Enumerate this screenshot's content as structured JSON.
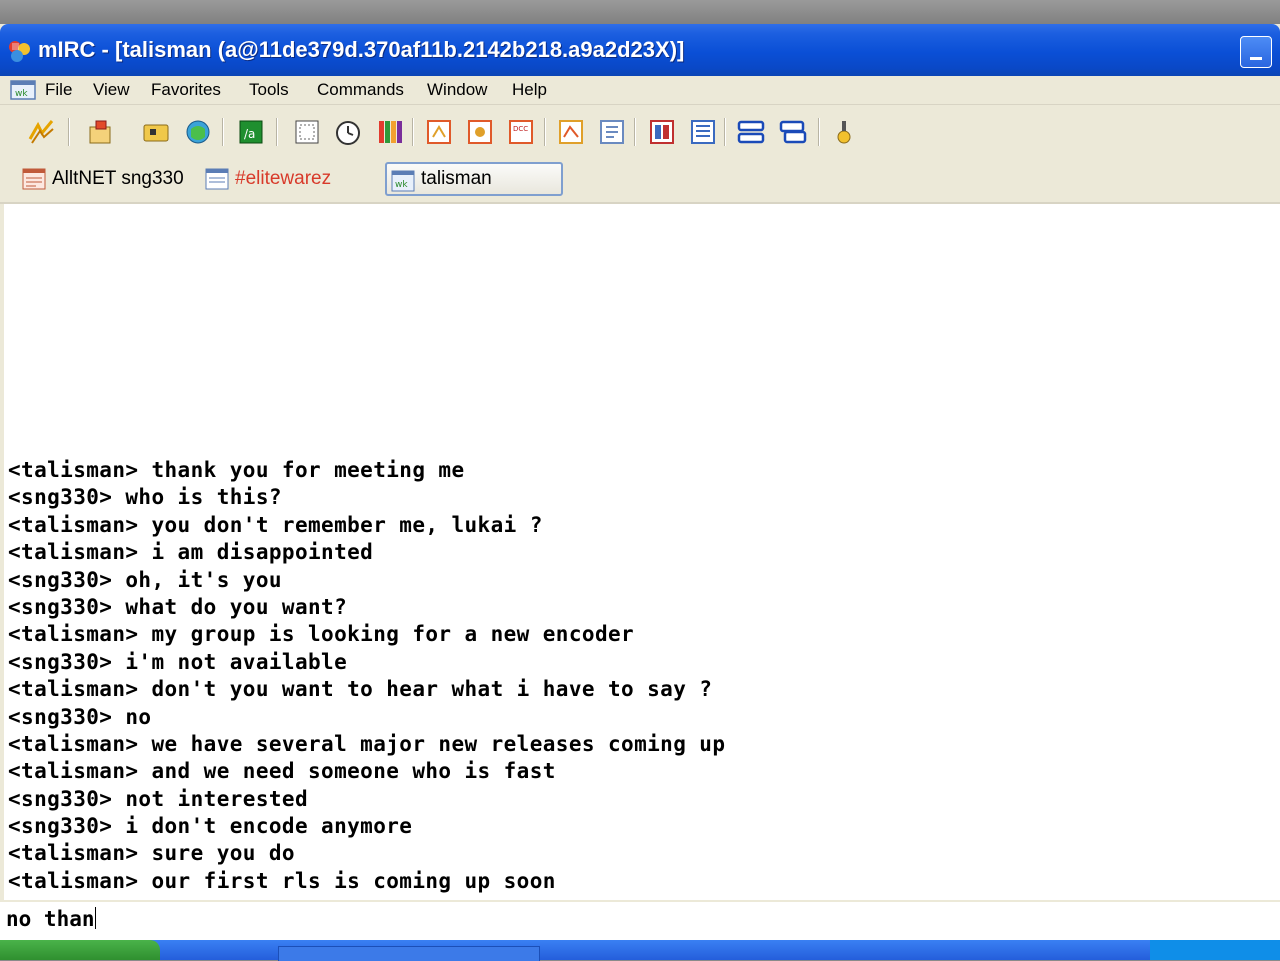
{
  "window": {
    "title": "mIRC - [talisman (a@11de379d.370af11b.2142b218.a9a2d23X)]"
  },
  "menu": {
    "items": [
      "File",
      "View",
      "Favorites",
      "Tools",
      "Commands",
      "Window",
      "Help"
    ]
  },
  "toolbar": {
    "buttons": [
      "connect-icon",
      "options-icon",
      "channels-list-icon",
      "address-book-icon",
      "scripts-editor-icon",
      "notify-list-icon",
      "timer-icon",
      "colors-icon",
      "send-file-icon",
      "chat-icon",
      "dcc-options-icon",
      "received-files-icon",
      "logs-icon",
      "tile-windows-icon",
      "cascade-windows-icon",
      "arrange-icon",
      "help-icon"
    ]
  },
  "switchbar": {
    "tabs": [
      {
        "label": "AlltNET sng330",
        "color": "#000000",
        "active": false
      },
      {
        "label": "#elitewarez",
        "color": "#d83a2a",
        "active": false
      },
      {
        "label": "talisman",
        "color": "#000000",
        "active": true
      }
    ]
  },
  "chat": {
    "lines": [
      "<talisman> thank you for meeting me",
      "<sng330> who is this?",
      "<talisman> you don't remember me, lukai ?",
      "<talisman> i am disappointed",
      "<sng330> oh, it's you",
      "<sng330> what do you want?",
      "<talisman> my group is looking for a new encoder",
      "<sng330> i'm not available",
      "<talisman> don't you want to hear what i have to say ?",
      "<sng330> no",
      "<talisman> we have several major new releases coming up",
      "<talisman> and we need someone who is fast",
      "<sng330> not interested",
      "<sng330> i don't encode anymore",
      "<talisman> sure you do",
      "<talisman> our first rls is coming up soon"
    ]
  },
  "input": {
    "value": "no than"
  },
  "colors": {
    "titlebar": "#0a4fd6",
    "chrome": "#ece9d8",
    "channel_highlight": "#d83a2a"
  }
}
